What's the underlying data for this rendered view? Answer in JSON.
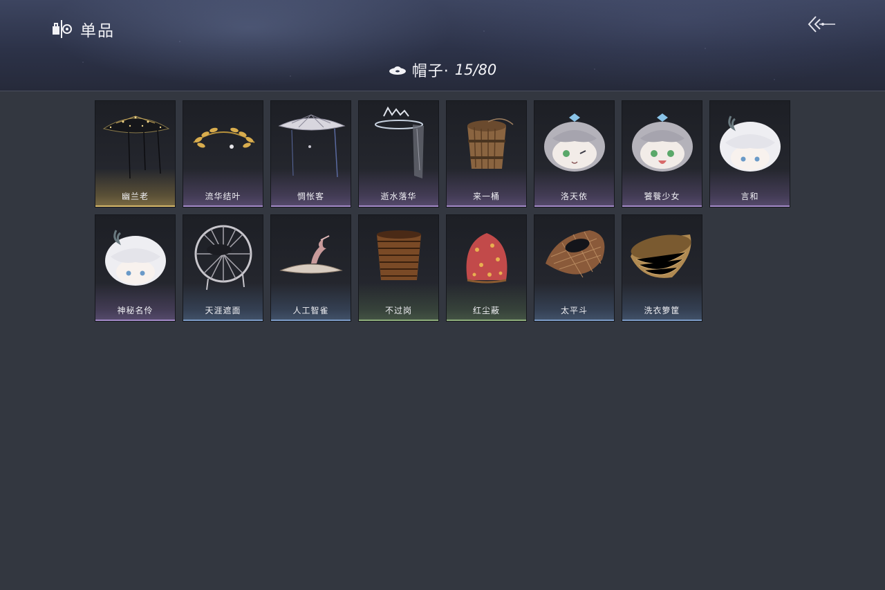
{
  "header": {
    "section_title": "单品",
    "section_icon": "wardrobe-icon",
    "back_icon": "back-arrow-icon"
  },
  "category": {
    "icon": "hat-icon",
    "label": "帽子·",
    "count": "15/80"
  },
  "rarity_colors": {
    "gold": "#d6b86a",
    "purple": "#a38ac8",
    "blue": "#7d9cc8",
    "green": "#8fae7c"
  },
  "items": [
    {
      "name": "幽兰老",
      "rarity": "gold",
      "art": "black-bamboo-hat"
    },
    {
      "name": "流华结叶",
      "rarity": "purple",
      "art": "golden-laurel"
    },
    {
      "name": "惆怅客",
      "rarity": "purple",
      "art": "veiled-bamboo-hat"
    },
    {
      "name": "逝水落华",
      "rarity": "purple",
      "art": "veil-tiara"
    },
    {
      "name": "来一桶",
      "rarity": "purple",
      "art": "wooden-bucket"
    },
    {
      "name": "洛天依",
      "rarity": "purple",
      "art": "grey-hair-head"
    },
    {
      "name": "饕餮少女",
      "rarity": "purple",
      "art": "grey-hair-head-smile"
    },
    {
      "name": "言和",
      "rarity": "purple",
      "art": "white-hair-head"
    },
    {
      "name": "神秘名伶",
      "rarity": "purple",
      "art": "white-hair-head-2"
    },
    {
      "name": "天涯遮面",
      "rarity": "blue",
      "art": "broken-frame-hat"
    },
    {
      "name": "人工智雀",
      "rarity": "blue",
      "art": "bird-hat"
    },
    {
      "name": "不过岗",
      "rarity": "green",
      "art": "stacked-bowls"
    },
    {
      "name": "红尘蔽",
      "rarity": "green",
      "art": "red-cloth-bag"
    },
    {
      "name": "太平斗",
      "rarity": "blue",
      "art": "woven-basket-hat"
    },
    {
      "name": "洗衣箩筐",
      "rarity": "blue",
      "art": "laundry-basket"
    }
  ]
}
